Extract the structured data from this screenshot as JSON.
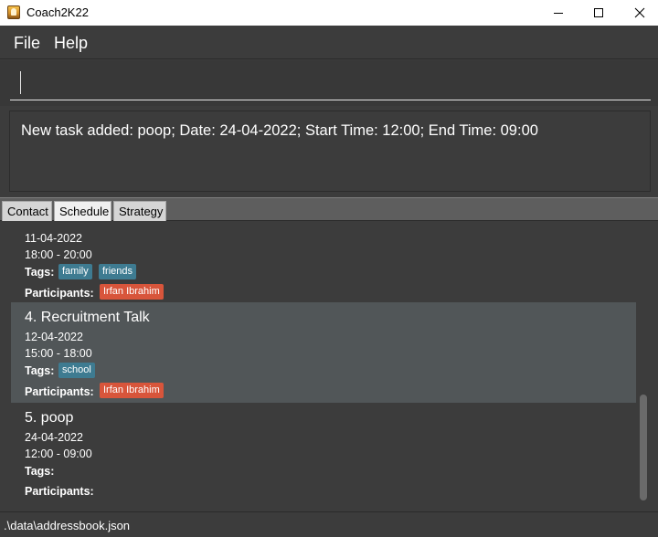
{
  "window": {
    "title": "Coach2K22",
    "icon": "coach-app-icon",
    "controls": {
      "minimize": "minimize-icon",
      "maximize": "maximize-icon",
      "close": "×"
    }
  },
  "menu": {
    "file": "File",
    "help": "Help"
  },
  "command": {
    "value": "",
    "placeholder": ""
  },
  "result": {
    "text": "New task added: poop; Date: 24-04-2022; Start Time: 12:00; End Time: 09:00"
  },
  "tabs": [
    {
      "label": "Contact",
      "selected": false
    },
    {
      "label": "Schedule",
      "selected": true
    },
    {
      "label": "Strategy",
      "selected": false
    }
  ],
  "tasks": [
    {
      "title": "",
      "date": "11-04-2022",
      "time": "18:00 - 20:00",
      "tags_label": "Tags:",
      "tags": [
        "family",
        "friends"
      ],
      "participants_label": "Participants:",
      "participants": [
        "Irfan Ibrahim"
      ]
    },
    {
      "title": "4.  Recruitment Talk",
      "date": "12-04-2022",
      "time": "15:00 - 18:00",
      "tags_label": "Tags:",
      "tags": [
        "school"
      ],
      "participants_label": "Participants:",
      "participants": [
        "Irfan Ibrahim"
      ]
    },
    {
      "title": "5.  poop",
      "date": "24-04-2022",
      "time": "12:00 - 09:00",
      "tags_label": "Tags:",
      "tags": [],
      "participants_label": "Participants:",
      "participants": []
    }
  ],
  "colors": {
    "background": "#3c3c3c",
    "selected_row": "#515658",
    "tag_chip": "#3e7b91",
    "participant_chip": "#d8553b"
  },
  "status": {
    "file_path": ".\\data\\addressbook.json"
  }
}
